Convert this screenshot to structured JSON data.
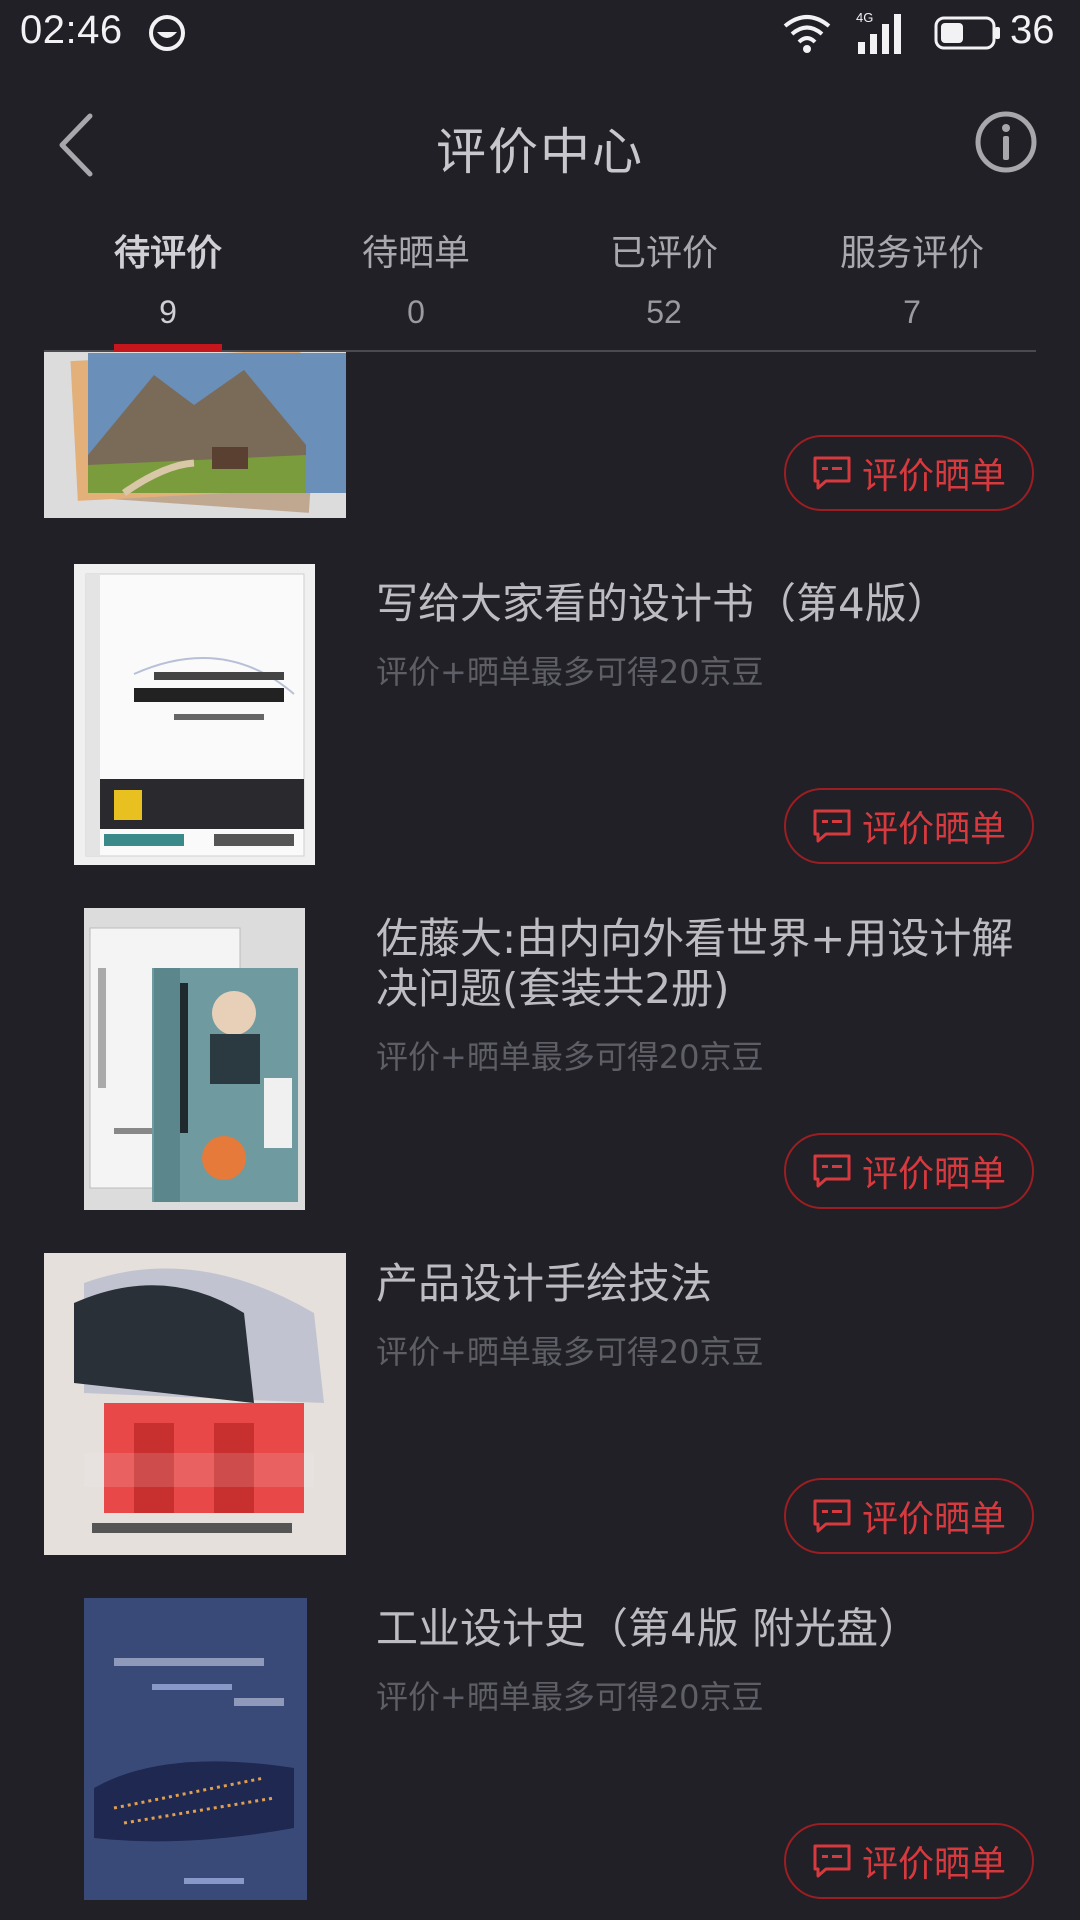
{
  "status_bar": {
    "time": "02:46",
    "network": "4G",
    "battery_level": "36",
    "icons": [
      "app-notification-icon",
      "wifi-icon",
      "cellular-signal-icon",
      "battery-icon"
    ]
  },
  "header": {
    "title": "评价中心",
    "back_icon": "chevron-left-icon",
    "info_icon": "info-circle-icon"
  },
  "tabs": [
    {
      "label": "待评价",
      "count": "9",
      "active": true
    },
    {
      "label": "待晒单",
      "count": "0",
      "active": false
    },
    {
      "label": "已评价",
      "count": "52",
      "active": false
    },
    {
      "label": "服务评价",
      "count": "7",
      "active": false
    }
  ],
  "items": [
    {
      "title": "",
      "subtitle": "",
      "button": "评价晒单",
      "cover": "landscape photo book cover"
    },
    {
      "title": "写给大家看的设计书（第4版）",
      "subtitle": "评价+晒单最多可得20京豆",
      "button": "评价晒单",
      "cover": "white design book cover"
    },
    {
      "title": "佐藤大:由内向外看世界+用设计解决问题(套装共2册)",
      "subtitle": "评价+晒单最多可得20京豆",
      "button": "评价晒单",
      "cover": "two-volume book set"
    },
    {
      "title": "产品设计手绘技法",
      "subtitle": "评价+晒单最多可得20京豆",
      "button": "评价晒单",
      "cover": "product sketching book cover"
    },
    {
      "title": "工业设计史（第4版 附光盘）",
      "subtitle": "评价+晒单最多可得20京豆",
      "button": "评价晒单",
      "cover": "navy industrial design history cover"
    }
  ],
  "colors": {
    "background": "#202026",
    "accent": "#c4161c",
    "button_border": "#9c1e22",
    "button_text": "#d63a3e"
  }
}
